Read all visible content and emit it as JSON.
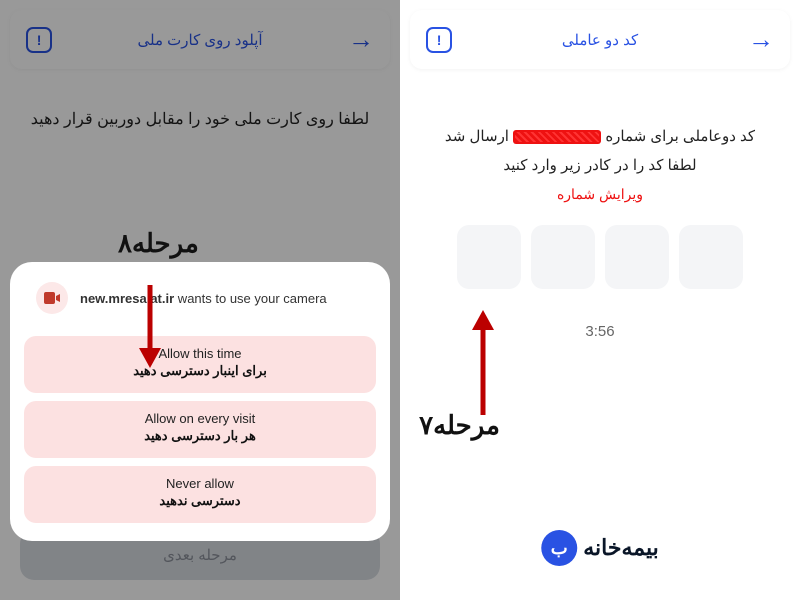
{
  "left": {
    "header": {
      "title": "کد دو عاملی"
    },
    "msg_prefix": "کد دوعاملی برای شماره",
    "msg_suffix": "ارسال شد",
    "msg_line2": "لطفا کد را در کادر زیر وارد کنید",
    "edit_link": "ویرایش شماره",
    "timer": "3:56",
    "step_label": "مرحله۷",
    "logo_text": "بیمه‌خانه"
  },
  "right": {
    "header": {
      "title": "آپلود روی کارت ملی"
    },
    "instruction": "لطفا روی کارت ملی خود را مقابل دوربین قرار دهید",
    "step_label": "مرحله۸",
    "dialog": {
      "site": "new.mresalat.ir",
      "wants": " wants to use your camera",
      "opts": [
        {
          "en": "Allow this time",
          "fa": "برای اینبار دسترسی دهید"
        },
        {
          "en": "Allow on every visit",
          "fa": "هر بار دسترسی دهید"
        },
        {
          "en": "Never allow",
          "fa": "دسترسی ندهید"
        }
      ]
    },
    "next": "مرحله بعدی"
  }
}
